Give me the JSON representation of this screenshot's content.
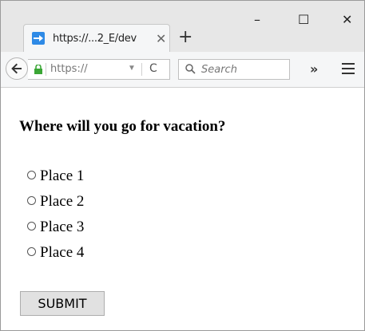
{
  "browser": {
    "tab_title": "https://...2_E/dev",
    "new_tab_icon": "plus-icon",
    "window_controls": {
      "minimize": "–",
      "maximize": "☐",
      "close": "✕"
    },
    "url_display": "https://",
    "search_placeholder": "Search",
    "overflow_label": "»"
  },
  "form": {
    "question": "Where will you go for vacation?",
    "options": [
      "Place 1",
      "Place 2",
      "Place 3",
      "Place 4"
    ],
    "submit_label": "SUBMIT"
  },
  "colors": {
    "tab_favicon": "#2e8ae6",
    "lock": "#3aa635"
  }
}
